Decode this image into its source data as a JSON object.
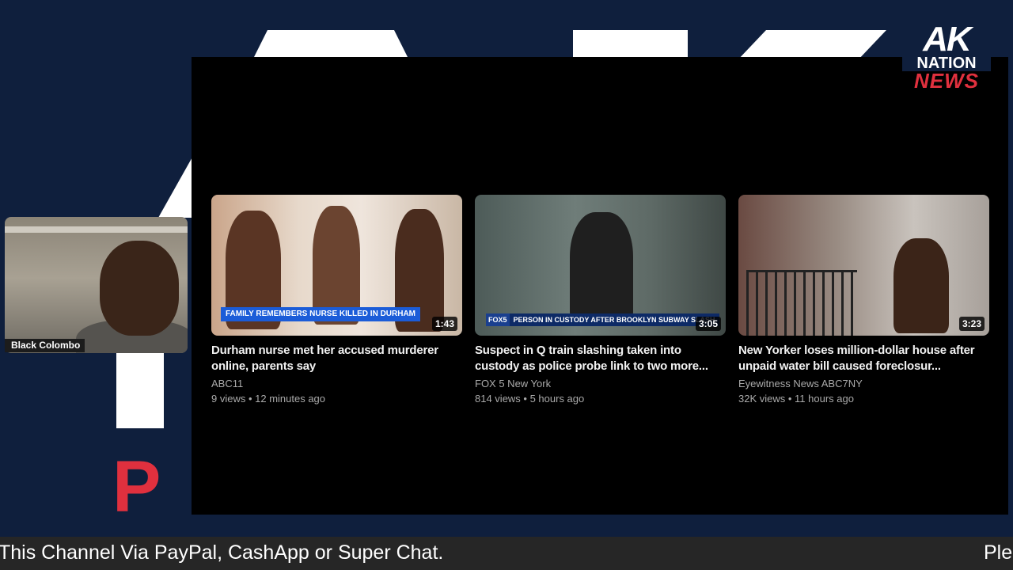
{
  "brand": {
    "line1": "AK",
    "line2": "NATION",
    "line3": "NEWS"
  },
  "webcam": {
    "name": "Black Colombo"
  },
  "videos": [
    {
      "thumb_caption": "FAMILY REMEMBERS NURSE KILLED IN DURHAM",
      "duration": "1:43",
      "title": "Durham nurse met her accused murderer online, parents say",
      "channel": "ABC11",
      "meta": "9 views • 12 minutes ago"
    },
    {
      "thumb_logo": "FOX5",
      "thumb_caption": "PERSON IN CUSTODY AFTER BROOKLYN SUBWAY SLASH",
      "duration": "3:05",
      "title": "Suspect in Q train slashing taken into custody as police probe link to two more...",
      "channel": "FOX 5 New York",
      "meta": "814 views • 5 hours ago"
    },
    {
      "duration": "3:23",
      "title": "New Yorker loses million-dollar house after unpaid water bill caused foreclosur...",
      "channel": "Eyewitness News ABC7NY",
      "meta": "32K views • 11 hours ago"
    }
  ],
  "ticker": {
    "text": "This Channel Via PayPal, CashApp or Super Chat.",
    "next": "Ple"
  },
  "colors": {
    "background": "#0f1f3d",
    "accent_red": "#e0303e",
    "caption_blue": "#1b5cd8"
  }
}
